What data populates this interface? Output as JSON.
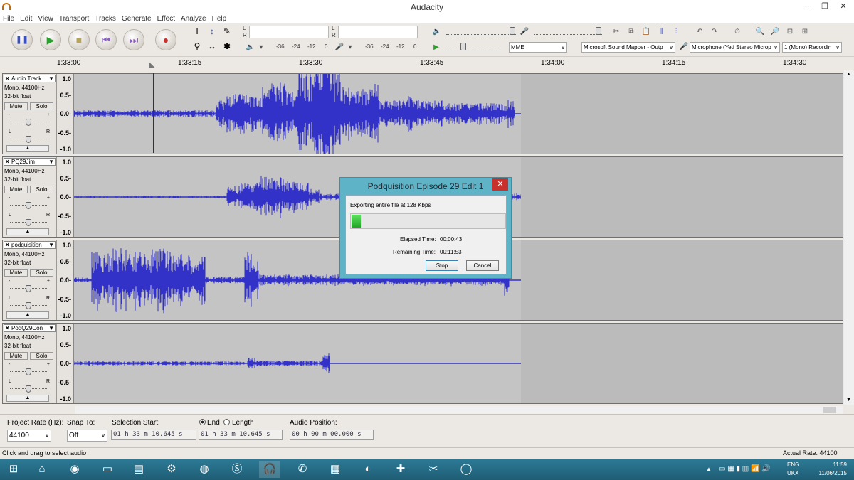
{
  "window": {
    "title": "Audacity",
    "minimize_glyph": "─",
    "maximize_glyph": "❐",
    "close_glyph": "✕"
  },
  "menu": [
    "File",
    "Edit",
    "View",
    "Transport",
    "Tracks",
    "Generate",
    "Effect",
    "Analyze",
    "Help"
  ],
  "transport": {
    "pause_glyph": "❚❚",
    "play_glyph": "▶",
    "stop_glyph": "■",
    "skip_start_glyph": "⏮",
    "skip_end_glyph": "⏭",
    "record_glyph": "●"
  },
  "tools": {
    "select": "I",
    "envelope": "↕",
    "draw": "✎",
    "zoom": "⚲",
    "timeshift": "↔",
    "multi": "✱"
  },
  "meters": {
    "rec_label_l": "L",
    "rec_label_r": "R",
    "play_label_l": "L",
    "play_label_r": "R",
    "play_db_labels": [
      "-36",
      "-24",
      "-12",
      "0"
    ],
    "rec_db_labels": [
      "-36",
      "-24",
      "-12",
      "0"
    ]
  },
  "devices": {
    "host": "MME",
    "playback": "Microsoft Sound Mapper - Outp",
    "recording": "Microphone (Yeti Stereo Microp",
    "channels": "1 (Mono) Recordin"
  },
  "ruler": {
    "labels": [
      "1:33:00",
      "1:33:15",
      "1:33:30",
      "1:33:45",
      "1:34:00",
      "1:34:15",
      "1:34:30"
    ]
  },
  "tracks": [
    {
      "name": "Audio Track",
      "format": "Mono, 44100Hz",
      "depth": "32-bit float",
      "mute": "Mute",
      "solo": "Solo",
      "scale": [
        "1.0",
        "0.5-",
        "0.0-",
        "-0.5-",
        "-1.0"
      ]
    },
    {
      "name": "PQ29Jim",
      "format": "Mono, 44100Hz",
      "depth": "32-bit float",
      "mute": "Mute",
      "solo": "Solo",
      "scale": [
        "1.0",
        "0.5-",
        "0.0-",
        "-0.5-",
        "-1.0"
      ]
    },
    {
      "name": "podquisition",
      "format": "Mono, 44100Hz",
      "depth": "32-bit float",
      "mute": "Mute",
      "solo": "Solo",
      "scale": [
        "1.0",
        "0.5-",
        "0.0-",
        "-0.5-",
        "-1.0"
      ]
    },
    {
      "name": "PodQ29Con",
      "format": "Mono, 44100Hz",
      "depth": "32-bit float",
      "mute": "Mute",
      "solo": "Solo",
      "scale": [
        "1.0",
        "0.5-",
        "0.0-",
        "-0.5-",
        "-1.0"
      ]
    }
  ],
  "slider_labels": {
    "l": "L",
    "r": "R",
    "minus": "-",
    "plus": "+"
  },
  "dialog": {
    "title": "Podquisition Episode 29 Edit 1",
    "message": "Exporting entire file at 128 Kbps",
    "progress": 0.06,
    "elapsed_label": "Elapsed Time:",
    "elapsed_value": "00:00:43",
    "remaining_label": "Remaining Time:",
    "remaining_value": "00:11:53",
    "stop": "Stop",
    "cancel": "Cancel"
  },
  "bottom": {
    "project_rate_label": "Project Rate (Hz):",
    "project_rate": "44100",
    "snap_to_label": "Snap To:",
    "snap_to": "Off",
    "selection_start_label": "Selection Start:",
    "selection_start": "01 h 33 m 10.645 s",
    "end_label": "End",
    "length_label": "Length",
    "selection_end": "01 h 33 m 10.645 s",
    "audio_position_label": "Audio Position:",
    "audio_position": "00 h 00 m 00.000 s"
  },
  "status": {
    "hint": "Click and drag to select audio",
    "rate": "Actual Rate: 44100"
  },
  "taskbar": {
    "lang1": "ENG",
    "lang2": "UKX",
    "time": "11:59",
    "date": "11/06/2015",
    "icons": [
      "windows-icon",
      "home-icon",
      "chrome-icon",
      "folder-icon",
      "notes-icon",
      "steam-icon",
      "firefox-icon",
      "skype-icon",
      "audacity-icon",
      "phone-icon",
      "disk-icon",
      "obs-icon",
      "gamepad-icon",
      "scissors-icon",
      "chat-icon"
    ]
  },
  "colors": {
    "waveform": "#3232c8",
    "selection": "#c5c4c5",
    "dialog_frame": "#5fb3c6",
    "progress": "#1fa524",
    "taskbar": "#236b86"
  }
}
